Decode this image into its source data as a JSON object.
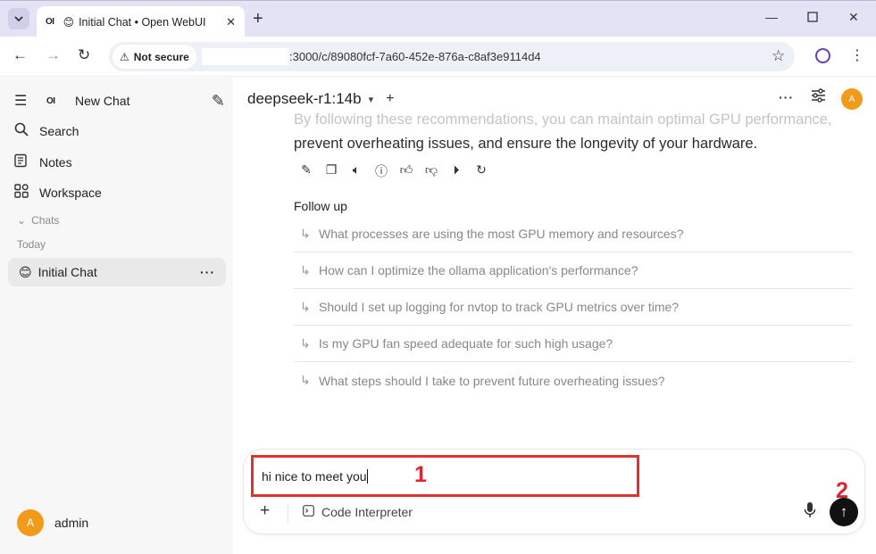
{
  "browser": {
    "tab": {
      "icon_text": "OI",
      "emoji": "😊",
      "title": "Initial Chat • Open WebUI"
    },
    "url_security": "Not secure",
    "url": ":3000/c/89080fcf-7a60-452e-876a-c8af3e9114d4",
    "icons": {
      "tab_menu": "chevron-down-icon",
      "close_tab": "close-icon",
      "new_tab": "plus-icon",
      "minimize": "minimize-icon",
      "maximize": "maximize-icon",
      "close_window": "close-icon",
      "back": "arrow-left-icon",
      "forward": "arrow-right-icon",
      "reload": "reload-icon",
      "warning": "warning-icon",
      "bookmark": "star-icon",
      "profile": "profile-icon",
      "menu": "kebab-menu-icon"
    }
  },
  "sidebar": {
    "logo_text": "OI",
    "new_chat": "New Chat",
    "items": [
      {
        "label": "Search",
        "icon": "search-icon"
      },
      {
        "label": "Notes",
        "icon": "notes-icon"
      },
      {
        "label": "Workspace",
        "icon": "workspace-icon"
      }
    ],
    "chats_label": "Chats",
    "today_label": "Today",
    "chat_item": {
      "emoji": "😊",
      "title": "Initial Chat"
    },
    "user": {
      "avatar": "A",
      "name": "admin"
    }
  },
  "main": {
    "model": "deepseek-r1:14b",
    "avatar": "A",
    "message_faded": "By following these recommendations, you can maintain optimal GPU performance,",
    "message": "prevent overheating issues, and ensure the longevity of your hardware.",
    "action_icons": [
      "edit-icon",
      "copy-icon",
      "speaker-icon",
      "info-icon",
      "thumbs-up-icon",
      "thumbs-down-icon",
      "play-icon",
      "regenerate-icon"
    ],
    "followup_title": "Follow up",
    "followups": [
      "What processes are using the most GPU memory and resources?",
      "How can I optimize the ollama application's performance?",
      "Should I set up logging for nvtop to track GPU metrics over time?",
      "Is my GPU fan speed adequate for such high usage?",
      "What steps should I take to prevent future overheating issues?"
    ]
  },
  "composer": {
    "input_value": "hi nice to meet you",
    "tool_label": "Code Interpreter",
    "annotations": {
      "one": "1",
      "two": "2"
    }
  },
  "colors": {
    "accent_avatar": "#f29b1b",
    "highlight_box": "#e03131"
  }
}
